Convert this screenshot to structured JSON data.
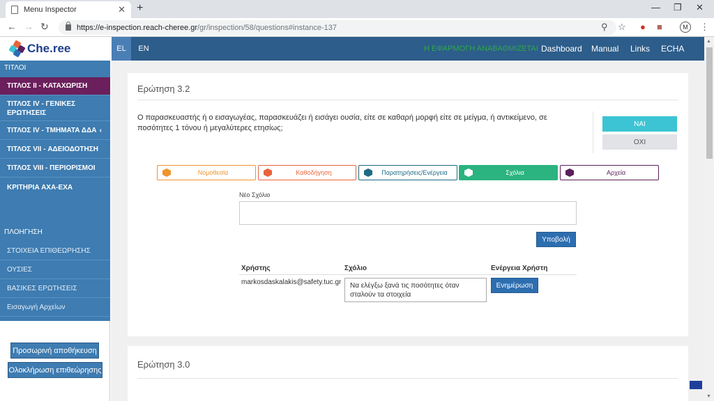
{
  "browser": {
    "tab_title": "Menu Inspector",
    "tab_close": "✕",
    "new_tab": "+",
    "url_host": "https://e-inspection.reach-cheree.gr",
    "url_path": "/gr/inspection/58/questions#instance-137",
    "profile_initial": "M"
  },
  "header": {
    "logo_text": "Che.ree",
    "lang_el": "EL",
    "lang_en": "EN",
    "notice": "Η ΕΦΑΡΜΟΓΗ ΑΝΑΒΑΘΜΙΖΕΤΑΙ",
    "links": [
      "Dashboard",
      "Manual",
      "Links",
      "ECHA"
    ]
  },
  "sidebar": {
    "titles_heading": "ΤΙΤΛΟΙ",
    "titles": [
      "ΤΙΤΛΟΣ ΙΙ - ΚΑΤΑΧΩΡΙΣΗ",
      "ΤΙΤΛΟΣ ΙV - ΓΕΝΙΚΕΣ ΕΡΩΤΗΣΕΙΣ",
      "ΤΙΤΛΟΣ ΙV - ΤΜΗΜΑΤΑ ΔΔΑ",
      "ΤΙΤΛΟΣ VII - ΑΔΕΙΟΔΟΤΗΣΗ",
      "ΤΙΤΛΟΣ VIII - ΠΕΡΙΟΡΙΣΜΟΙ",
      "ΚΡΙΤΗΡΙΑ ΑΧΑ-ΕΧΑ"
    ],
    "nav_heading": "ΠΛΟΗΓΗΣΗ",
    "nav": [
      "ΣΤΟΙΧΕΙΑ ΕΠΙΘΕΩΡΗΣΗΣ",
      "ΟΥΣΙΕΣ",
      "ΒΑΣΙΚΕΣ ΕΡΩΤΗΣΕΙΣ",
      "Εισαγωγή Αρχείων"
    ],
    "save_button": "Προσωρινή αποθήκευση",
    "complete_button": "Ολοκλήρωση επιθεώρησης"
  },
  "question": {
    "title": "Ερώτηση 3.2",
    "text": "Ο παρασκευαστής ή ο εισαγωγέας, παρασκευάζει ή εισάγει ουσία, είτε σε καθαρή μορφή είτε σε μείγμα, ή αντικείμενο, σε ποσότητες 1 τόνου ή μεγαλύτερες ετησίως;",
    "yes": "ΝΑΙ",
    "no": "ΟΧΙ",
    "tabs": [
      "Νομοθεσία",
      "Καθοδήγηση",
      "Παρατηρήσεις/Ενέργεια",
      "Σχόλια",
      "Αρχεία"
    ],
    "new_comment_label": "Νέο Σχόλιο",
    "submit": "Υποβολή",
    "table_headers": [
      "Χρήστης",
      "Σχόλιο",
      "Ενέργεια Χρήστη"
    ],
    "comment_user": "markosdaskalakis@safety.tuc.gr",
    "comment_text": "Να ελέγξω ξανά τις ποσότητες όταν σταλούν τα στοιχεία",
    "update": "Ενημέρωση"
  },
  "next_question": {
    "title": "Ερώτηση 3.0"
  },
  "colors": {
    "header": "#2d5d8a",
    "sidebar": "#3e7cb1",
    "active_item": "#6b1f5c",
    "yes": "#3cc4d4",
    "tab_orange": "#f0932b",
    "tab_orange2": "#e8643a",
    "tab_teal": "#1c6b84",
    "tab_green": "#2bb380",
    "tab_purple": "#5a1f5c"
  }
}
